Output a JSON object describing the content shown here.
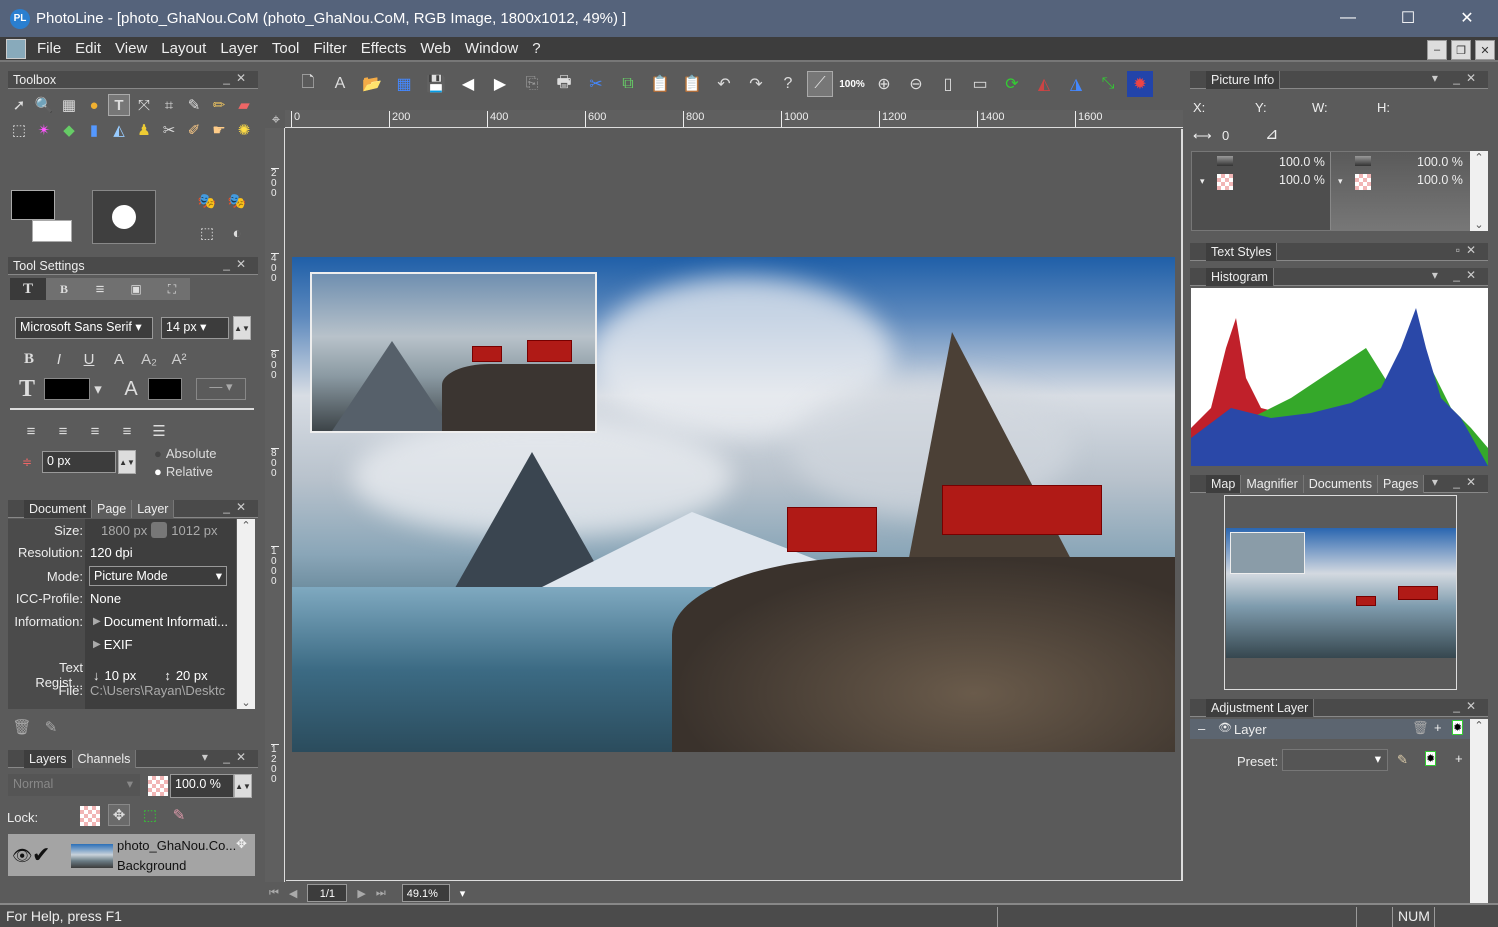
{
  "window": {
    "title": "PhotoLine - [photo_GhaNou.CoM (photo_GhaNou.CoM, RGB Image, 1800x1012, 49%) ]",
    "app_logo": "PL",
    "minimize": "—",
    "maximize": "☐",
    "close": "✕"
  },
  "menu": [
    "File",
    "Edit",
    "View",
    "Layout",
    "Layer",
    "Tool",
    "Filter",
    "Effects",
    "Web",
    "Window",
    "?"
  ],
  "toolbox": {
    "title": "Toolbox",
    "tools": [
      "select-arrow",
      "magnifier",
      "grid-crop",
      "color-picker-ball",
      "text",
      "transform",
      "crop",
      "pipette",
      "pencil",
      "eraser",
      "rect-select",
      "magic-wand",
      "clone-stamp",
      "gradient",
      "fill-bucket",
      "stamp",
      "smudge",
      "brush",
      "retouch",
      "light"
    ]
  },
  "tool_settings": {
    "title": "Tool Settings",
    "tabs": [
      "T",
      "B",
      "≡",
      "▣",
      "⛶"
    ],
    "font": "Microsoft Sans Serif",
    "size": "14 px",
    "style_buttons": [
      "B",
      "I",
      "U",
      "A",
      "A₂",
      "A²"
    ],
    "spacing": "0 px",
    "radio": [
      {
        "label": "Absolute",
        "checked": false
      },
      {
        "label": "Relative",
        "checked": true
      }
    ]
  },
  "document_panel": {
    "tabs": [
      "Document",
      "Page",
      "Layer"
    ],
    "rows": [
      {
        "label": "Size:",
        "value": "1800 px",
        "value2": "1012 px"
      },
      {
        "label": "Resolution:",
        "value": "120 dpi"
      },
      {
        "label": "Mode:",
        "value": "Picture Mode"
      },
      {
        "label": "ICC-Profile:",
        "value": "None"
      },
      {
        "label": "Information:",
        "value": "Document Informati..."
      },
      {
        "label": "",
        "value": "EXIF"
      },
      {
        "label": "Text Regist...",
        "value": "10 px",
        "value2": "20 px"
      },
      {
        "label": "File:",
        "value": "C:\\Users\\Rayan\\Desktc"
      }
    ]
  },
  "layers_panel": {
    "tabs": [
      "Layers",
      "Channels"
    ],
    "blend_mode": "Normal",
    "opacity": "100.0 %",
    "lock_label": "Lock:",
    "layer": {
      "name": "photo_GhaNou.Co...",
      "sub": "Background",
      "visible": true
    }
  },
  "toolbar": {
    "zoom_label": "100%"
  },
  "rulers": {
    "h": [
      "0",
      "200",
      "400",
      "600",
      "800",
      "1000",
      "1200",
      "1400",
      "1600"
    ],
    "v": [
      "200",
      "400",
      "600",
      "800",
      "1000",
      "1200"
    ]
  },
  "navigation": {
    "page": "1/1",
    "zoom": "49.1%"
  },
  "picture_info": {
    "title": "Picture Info",
    "x": "X:",
    "y": "Y:",
    "w": "W:",
    "h": "H:",
    "distance": "0",
    "opacities": [
      "100.0 %",
      "100.0 %",
      "100.0 %",
      "100.0 %"
    ]
  },
  "text_styles": {
    "title": "Text Styles"
  },
  "histogram": {
    "title": "Histogram"
  },
  "map_panel": {
    "tabs": [
      "Map",
      "Magnifier",
      "Documents",
      "Pages"
    ]
  },
  "adjustment": {
    "title": "Adjustment Layer",
    "layer_label": "Layer",
    "preset_label": "Preset:",
    "preset_value": ""
  },
  "status": {
    "help": "For Help, press F1",
    "num": "NUM"
  }
}
